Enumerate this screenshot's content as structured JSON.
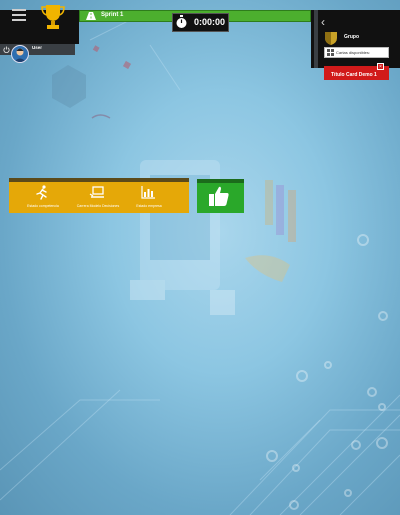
{
  "header": {
    "sprint_label": "Sprint 1",
    "timer": "0:00:00"
  },
  "user": {
    "name": "User"
  },
  "group_panel": {
    "group_label": "Grupo",
    "cards_button_label": "Cartas disponibles:",
    "card_title": "Título Card Demo 1"
  },
  "menu": {
    "items": [
      {
        "label": "Estado competencia",
        "icon": "running-person-icon"
      },
      {
        "label": "Carrera Modelo Decisiones",
        "icon": "laptop-icon"
      },
      {
        "label": "Estado empresa",
        "icon": "bar-chart-icon"
      }
    ],
    "approve_icon": "thumbs-up-icon"
  },
  "colors": {
    "sprint_green": "#4caf2e",
    "menu_yellow": "#e5a808",
    "approve_green": "#2aa82a",
    "card_red": "#d11a1a",
    "panel_dark": "#111111"
  }
}
